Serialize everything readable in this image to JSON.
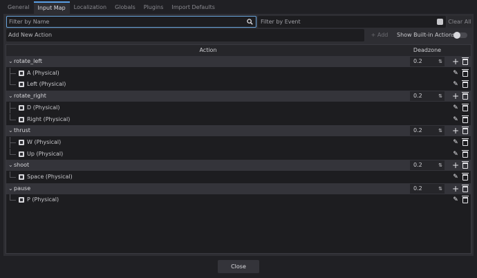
{
  "tabs": [
    "General",
    "Input Map",
    "Localization",
    "Globals",
    "Plugins",
    "Import Defaults"
  ],
  "active_tab": "Input Map",
  "filter_name_placeholder": "Filter by Name",
  "filter_event_placeholder": "Filter by Event",
  "clear_all_label": "Clear All",
  "add_action_placeholder": "Add New Action",
  "add_label": "+ Add",
  "show_builtin_label": "Show Built-in Actions",
  "header": {
    "action": "Action",
    "deadzone": "Deadzone"
  },
  "actions": [
    {
      "name": "rotate_left",
      "deadzone": "0.2",
      "events": [
        "A (Physical)",
        "Left (Physical)"
      ]
    },
    {
      "name": "rotate_right",
      "deadzone": "0.2",
      "events": [
        "D (Physical)",
        "Right (Physical)"
      ]
    },
    {
      "name": "thrust",
      "deadzone": "0.2",
      "events": [
        "W (Physical)",
        "Up (Physical)"
      ]
    },
    {
      "name": "shoot",
      "deadzone": "0.2",
      "events": [
        "Space (Physical)"
      ]
    },
    {
      "name": "pause",
      "deadzone": "0.2",
      "events": [
        "P (Physical)"
      ]
    }
  ],
  "close_label": "Close",
  "colors": {
    "accent": "#5aa0e6",
    "bg": "#202024",
    "panel": "#2e2e33"
  }
}
